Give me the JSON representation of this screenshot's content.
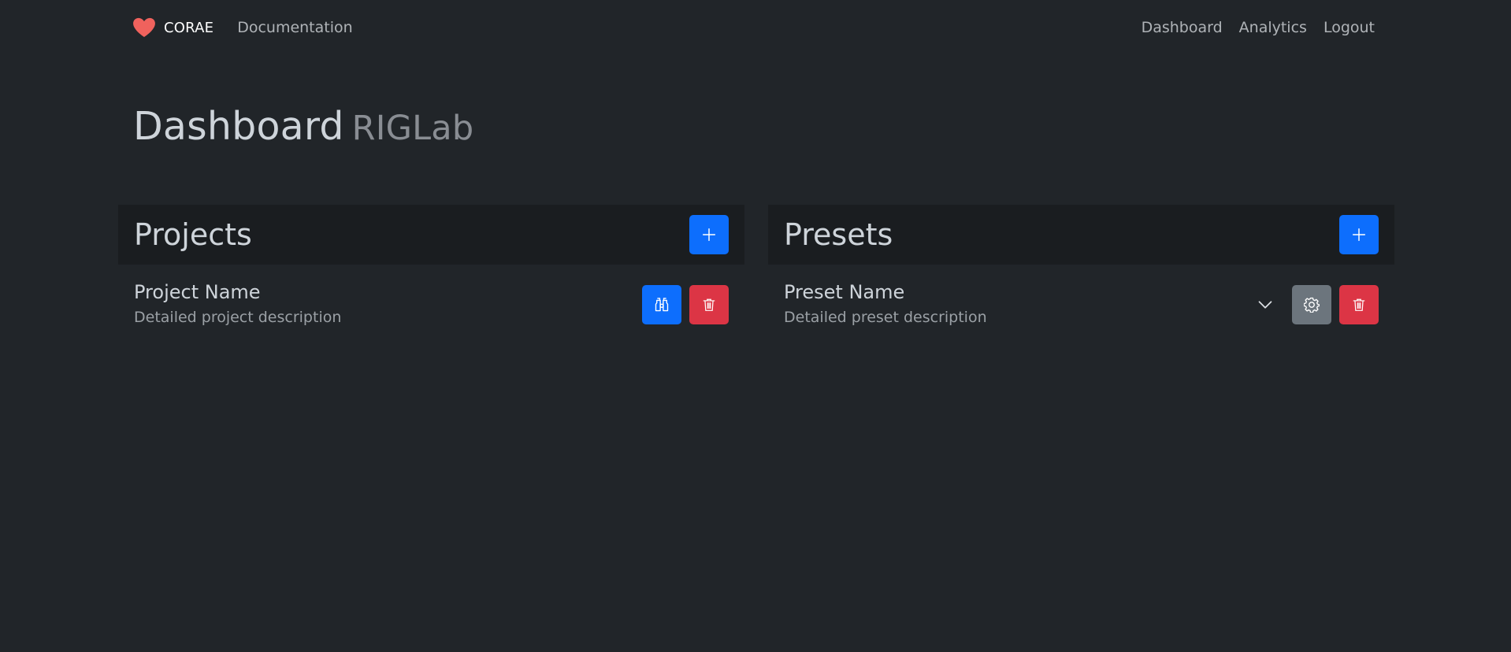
{
  "nav": {
    "brand": "CORAE",
    "documentation": "Documentation",
    "dashboard": "Dashboard",
    "analytics": "Analytics",
    "logout": "Logout"
  },
  "page": {
    "title": "Dashboard",
    "subtitle": "RIGLab"
  },
  "projects": {
    "title": "Projects",
    "items": [
      {
        "name": "Project Name",
        "description": "Detailed project description"
      }
    ]
  },
  "presets": {
    "title": "Presets",
    "items": [
      {
        "name": "Preset Name",
        "description": "Detailed preset description"
      }
    ]
  },
  "colors": {
    "background": "#212529",
    "panel_header": "#1a1d20",
    "primary": "#0d6efd",
    "danger": "#dc3545",
    "secondary": "#6c757d",
    "brand_heart": "#f0625d"
  },
  "icons": {
    "brand": "heart-icon",
    "add": "plus-icon",
    "view": "binoculars-icon",
    "delete": "trash-icon",
    "settings": "gear-icon",
    "expand": "chevron-down-icon"
  }
}
